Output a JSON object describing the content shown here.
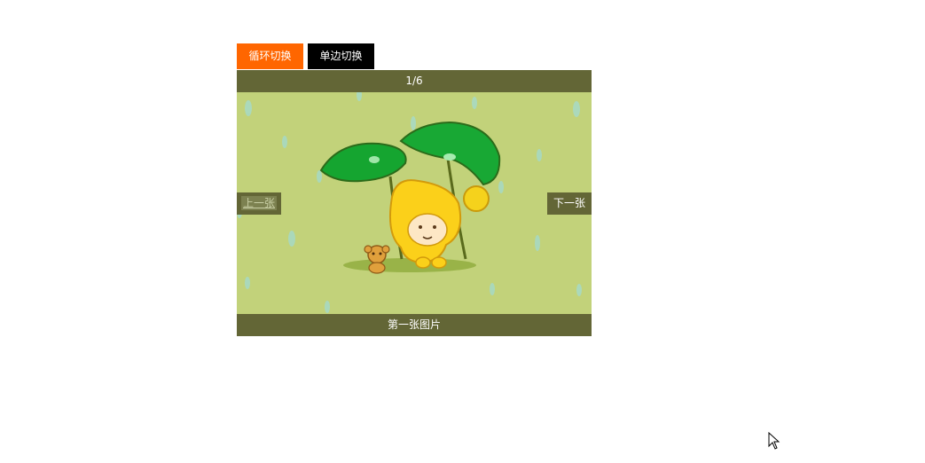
{
  "tabs": {
    "loop_label": "循环切换",
    "single_label": "单边切换"
  },
  "slider": {
    "counter": "1/6",
    "caption": "第一张图片",
    "prev_label": "上一张",
    "next_label": "下一张"
  },
  "colors": {
    "loop_tab": "#ff6600",
    "single_tab": "#000000",
    "bar": "#636636",
    "slide_bg": "#c2d27a"
  }
}
